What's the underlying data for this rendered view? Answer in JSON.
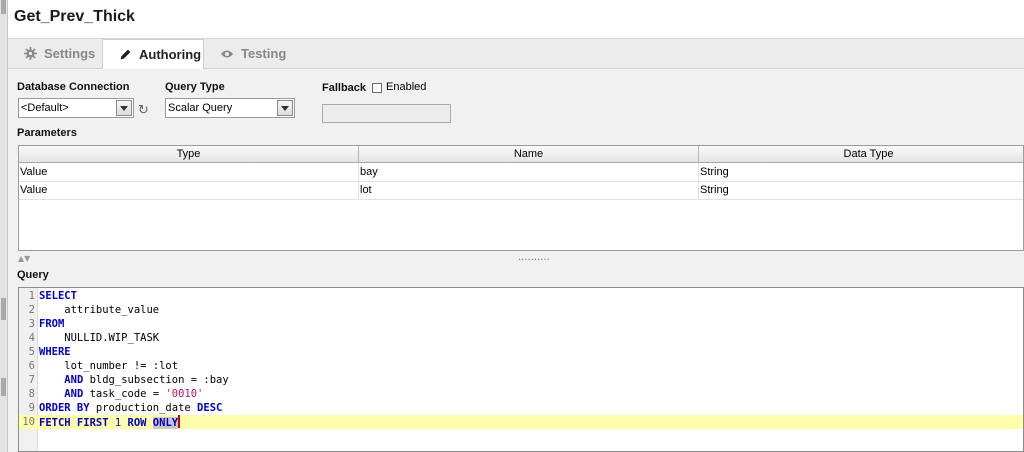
{
  "title": "Get_Prev_Thick",
  "tabs": [
    {
      "label": "Settings",
      "icon": "gear-icon",
      "active": false
    },
    {
      "label": "Authoring",
      "icon": "pencil-icon",
      "active": true
    },
    {
      "label": "Testing",
      "icon": "eye-icon",
      "active": false
    }
  ],
  "form": {
    "db_label": "Database Connection",
    "db_value": "<Default>",
    "qt_label": "Query Type",
    "qt_value": "Scalar Query",
    "fallback_label": "Fallback",
    "enabled_label": "Enabled",
    "enabled_checked": false,
    "fallback_value": ""
  },
  "parameters": {
    "label": "Parameters",
    "columns": [
      "Type",
      "Name",
      "Data Type"
    ],
    "rows": [
      [
        "Value",
        "bay",
        "String"
      ],
      [
        "Value",
        "lot",
        "String"
      ]
    ]
  },
  "query": {
    "label": "Query",
    "splitter_grip": "··········",
    "lines": [
      {
        "n": "1",
        "tokens": [
          {
            "t": "SELECT",
            "c": "kw"
          }
        ]
      },
      {
        "n": "2",
        "tokens": [
          {
            "t": "    attribute_value",
            "c": ""
          }
        ]
      },
      {
        "n": "3",
        "tokens": [
          {
            "t": "FROM",
            "c": "kw"
          }
        ]
      },
      {
        "n": "4",
        "tokens": [
          {
            "t": "    NULLID.WIP_TASK",
            "c": ""
          }
        ]
      },
      {
        "n": "5",
        "tokens": [
          {
            "t": "WHERE",
            "c": "kw"
          }
        ]
      },
      {
        "n": "6",
        "tokens": [
          {
            "t": "    lot_number != :lot",
            "c": ""
          }
        ]
      },
      {
        "n": "7",
        "tokens": [
          {
            "t": "    ",
            "c": ""
          },
          {
            "t": "AND",
            "c": "kw"
          },
          {
            "t": " bldg_subsection = :bay",
            "c": ""
          }
        ]
      },
      {
        "n": "8",
        "tokens": [
          {
            "t": "    ",
            "c": ""
          },
          {
            "t": "AND",
            "c": "kw"
          },
          {
            "t": " task_code = ",
            "c": ""
          },
          {
            "t": "'0010'",
            "c": "st"
          }
        ]
      },
      {
        "n": "9",
        "tokens": [
          {
            "t": "ORDER BY",
            "c": "kw"
          },
          {
            "t": " production_date ",
            "c": ""
          },
          {
            "t": "DESC",
            "c": "kw"
          }
        ]
      },
      {
        "n": "10",
        "highlight": true,
        "tokens": [
          {
            "t": "FETCH FIRST ",
            "c": "kw"
          },
          {
            "t": "1",
            "c": "nm"
          },
          {
            "t": " ROW ",
            "c": "kw"
          },
          {
            "t": "ONLY",
            "c": "kw sel"
          },
          {
            "t": "",
            "c": "caret"
          }
        ]
      }
    ]
  }
}
